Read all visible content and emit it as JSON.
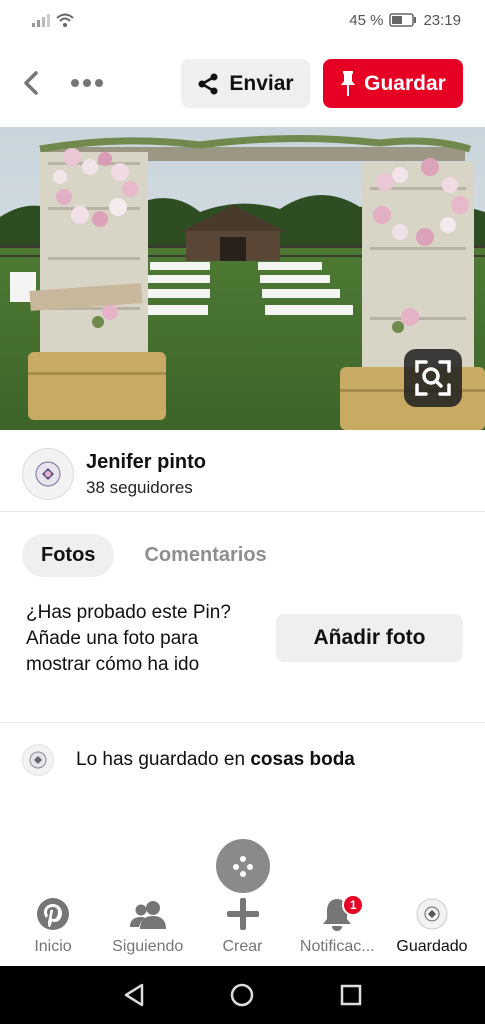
{
  "status_bar": {
    "battery_percent": "45 %",
    "time": "23:19",
    "icons": [
      "signal-icon",
      "wifi-icon",
      "battery-icon"
    ]
  },
  "top_bar": {
    "back_icon": "chevron-left-icon",
    "more_icon": "more-dots-icon",
    "send_label": "Enviar",
    "save_label": "Guardar"
  },
  "pin": {
    "image_icon": "visual-search-icon"
  },
  "creator": {
    "name": "Jenifer pinto",
    "followers": "38 seguidores"
  },
  "tabs": [
    {
      "label": "Fotos",
      "active": true
    },
    {
      "label": "Comentarios",
      "active": false
    }
  ],
  "tried": {
    "prompt": "¿Has probado este Pin? Añade una foto para mostrar cómo ha ido",
    "button_label": "Añadir foto"
  },
  "saved": {
    "prefix": "Lo has guardado en",
    "board": "cosas boda"
  },
  "bottom_nav": [
    {
      "label": "Inicio",
      "icon": "pinterest-icon",
      "active": false
    },
    {
      "label": "Siguiendo",
      "icon": "people-icon",
      "active": false
    },
    {
      "label": "Crear",
      "icon": "plus-icon",
      "active": false
    },
    {
      "label": "Notificac...",
      "icon": "bell-icon",
      "active": false,
      "badge": "1"
    },
    {
      "label": "Guardado",
      "icon": "profile-avatar-icon",
      "active": true
    }
  ],
  "colors": {
    "accent": "#e60023",
    "button_gray": "#efefef",
    "muted_text": "#767676"
  }
}
